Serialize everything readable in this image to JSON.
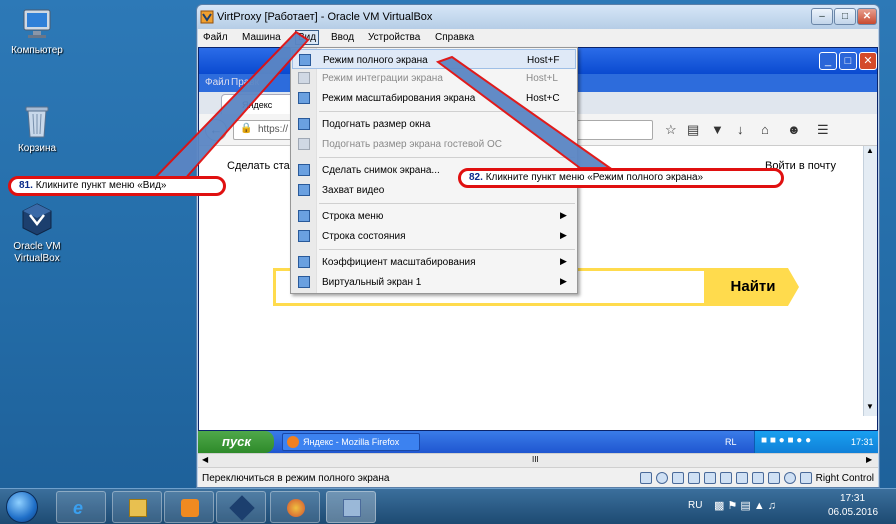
{
  "desktop": {
    "icons": [
      {
        "label": "Компьютер",
        "icon": "computer-icon"
      },
      {
        "label": "Корзина",
        "icon": "recycle-bin-icon"
      },
      {
        "label": "Oracle VM VirtualBox",
        "icon": "virtualbox-icon"
      }
    ]
  },
  "vbox": {
    "title": "VirtProxy [Работает] - Oracle VM VirtualBox",
    "menu": [
      "Файл",
      "Машина",
      "Вид",
      "Ввод",
      "Устройства",
      "Справка"
    ],
    "status_text": "Переключиться в режим полного экрана",
    "host_key": "Right Control",
    "scroll_mark": "III"
  },
  "guest": {
    "ff_menu": [
      "Файл",
      "Правк"
    ],
    "tab_label": "Яндекс",
    "url": "https://",
    "content": {
      "left_text": "Сделать стар",
      "right_text": "Войти в почту",
      "search_button": "Найти"
    },
    "xp_taskbar": {
      "start": "пуск",
      "task": "Яндекс - Mozilla Firefox",
      "lang": "RL",
      "time": "17:31"
    }
  },
  "view_menu": {
    "items": [
      {
        "label": "Режим полного экрана",
        "shortcut": "Host+F",
        "icon": "fullscreen-icon",
        "disabled": false,
        "submenu": false
      },
      {
        "label": "Режим интеграции экрана",
        "shortcut": "Host+L",
        "icon": "seamless-icon",
        "disabled": true,
        "submenu": false
      },
      {
        "label": "Режим масштабирования экрана",
        "shortcut": "Host+C",
        "icon": "scale-mode-icon",
        "disabled": false,
        "submenu": false
      },
      {
        "label": "Подогнать размер окна",
        "shortcut": "",
        "icon": "adjust-window-icon",
        "disabled": false,
        "submenu": false
      },
      {
        "label": "Подогнать размер экрана гостевой ОС",
        "shortcut": "",
        "icon": "guest-autoresize-icon",
        "disabled": true,
        "submenu": false
      },
      {
        "label": "Сделать снимок экрана...",
        "shortcut": "",
        "icon": "screenshot-icon",
        "disabled": false,
        "submenu": false
      },
      {
        "label": "Захват видео",
        "shortcut": "",
        "icon": "video-capture-icon",
        "disabled": false,
        "submenu": false
      },
      {
        "label": "Строка меню",
        "shortcut": "",
        "icon": "menu-bar-icon",
        "disabled": false,
        "submenu": true
      },
      {
        "label": "Строка состояния",
        "shortcut": "",
        "icon": "status-bar-icon",
        "disabled": false,
        "submenu": true
      },
      {
        "label": "Коэффициент масштабирования",
        "shortcut": "",
        "icon": "scale-factor-icon",
        "disabled": false,
        "submenu": true
      },
      {
        "label": "Виртуальный экран 1",
        "shortcut": "",
        "icon": "virtual-screen-icon",
        "disabled": false,
        "submenu": true
      }
    ]
  },
  "annotations": [
    {
      "step": "81.",
      "text": "Кликните пункт меню «Вид»"
    },
    {
      "step": "82.",
      "text": "Кликните пункт меню «Режим полного экрана»"
    }
  ],
  "win7": {
    "lang": "RU",
    "time": "17:31",
    "date": "06.05.2016"
  },
  "colors": {
    "annotation_border": "#e01010",
    "arrow_fill": "#5b86c4",
    "yandex_yellow": "#ffdb4d"
  }
}
